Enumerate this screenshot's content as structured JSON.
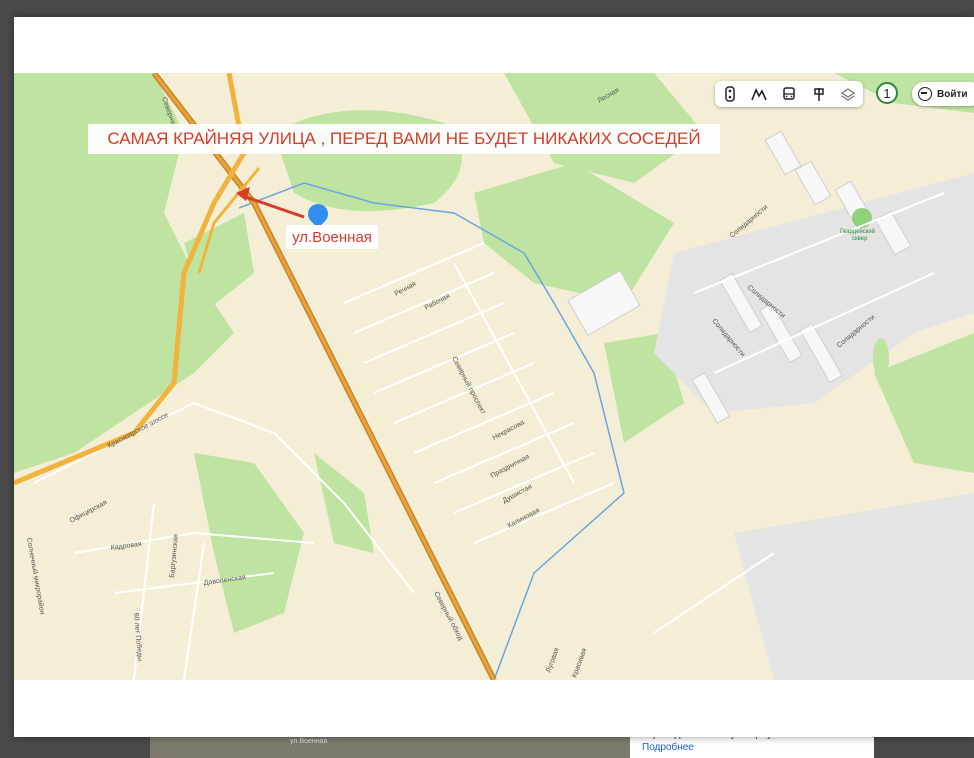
{
  "banner_text": "САМАЯ КРАЙНЯЯ УЛИЦА , ПЕРЕД ВАМИ НЕ БУДЕТ НИКАКИХ СОСЕДЕЙ",
  "pin_label": "ул.Военная",
  "toolbar": {
    "icons": [
      "traffic-icon",
      "terrain-icon",
      "transit-icon",
      "panorama-icon",
      "layers-icon"
    ]
  },
  "counter": "1",
  "login_label": "Войти",
  "streets": {
    "lesnaya": "Лесная",
    "solidarnosti": "Солидарности",
    "gvardeysky": "Гвардейский",
    "skver": "сквер",
    "rechnaya": "Речная",
    "rabochaya": "Рабочая",
    "severny_prospect": "Северный проспект",
    "nekrasova": "Некрасова",
    "prazdnichnaya": "Праздничная",
    "dushistaya": "Душистая",
    "kalinovaya": "Калиновая",
    "krasnoyarskoe": "Красноярское шоссе",
    "oficerskaya": "Офицерская",
    "kadrovaya": "Кадровая",
    "barguzinskaya": "Баргузинская",
    "dovolenskaya": "Доволенская",
    "let_pobedy": "60 лет Победы",
    "solnechny": "Солнечный микрорайон",
    "severny_obhod": "Северный обход",
    "lugovaya": "Луговая",
    "krasivaya": "Красивая",
    "severnaya": "Северная"
  },
  "background": {
    "thumb_label": "ул.Военная",
    "text": "переводим вам. Эту защиту нельзя отключить.",
    "more_link": "Подробнее"
  }
}
